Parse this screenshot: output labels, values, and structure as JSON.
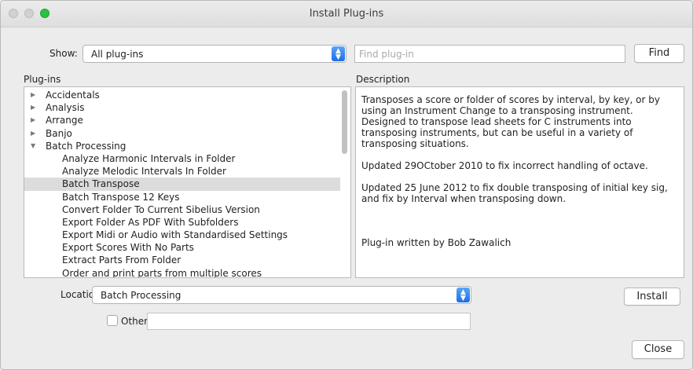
{
  "window": {
    "title": "Install Plug-ins"
  },
  "show": {
    "label": "Show:",
    "selected": "All plug-ins"
  },
  "search": {
    "placeholder": "Find plug-in",
    "value": ""
  },
  "find_button": "Find",
  "plugins_label": "Plug-ins",
  "description_label": "Description",
  "plugins": {
    "categories": [
      {
        "label": "Accidentals",
        "expanded": false
      },
      {
        "label": "Analysis",
        "expanded": false
      },
      {
        "label": "Arrange",
        "expanded": false
      },
      {
        "label": "Banjo",
        "expanded": false
      },
      {
        "label": "Batch Processing",
        "expanded": true
      }
    ],
    "items": [
      {
        "label": "Analyze Harmonic Intervals in Folder"
      },
      {
        "label": "Analyze Melodic Intervals In Folder"
      },
      {
        "label": "Batch Transpose",
        "selected": true
      },
      {
        "label": "Batch Transpose 12 Keys"
      },
      {
        "label": "Convert Folder To Current Sibelius Version"
      },
      {
        "label": "Export Folder As PDF With Subfolders"
      },
      {
        "label": "Export Midi or Audio with Standardised Settings"
      },
      {
        "label": "Export Scores With No Parts"
      },
      {
        "label": "Extract Parts From Folder"
      },
      {
        "label": "Order and print parts from multiple scores"
      }
    ]
  },
  "description": {
    "p1": "Transposes a score or folder of scores by interval, by key, or by using an Instrument Change to a transposing instrument. Designed to transpose lead sheets for C instruments into transposing instruments, but can be useful in a variety of transposing situations.",
    "p2": "Updated 29OCtober 2010 to fix incorrect handling of octave.",
    "p3": "Updated 25 June 2012 to fix double transposing of initial key sig, and fix by Interval when transposing down.",
    "author": "Plug-in written by Bob Zawalich"
  },
  "location": {
    "label": "Location:",
    "selected": "Batch Processing"
  },
  "install_button": "Install",
  "other": {
    "label": "Other",
    "checked": false,
    "value": ""
  },
  "close_button": "Close",
  "colors": {
    "accent": "#1a6fe8",
    "selection": "#dcdcdc",
    "window_bg": "#ececec"
  }
}
